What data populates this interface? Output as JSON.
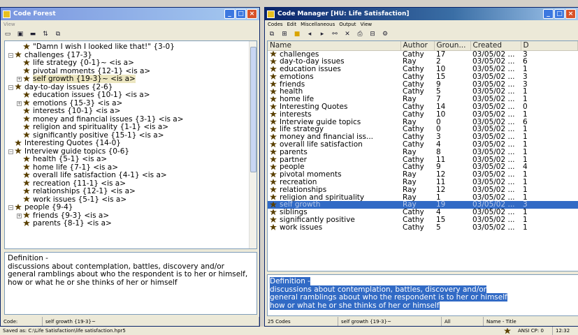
{
  "left_window": {
    "title": "Code Forest",
    "menu": [
      "View"
    ],
    "tree": [
      {
        "indent": 1,
        "expander": "",
        "label": "\"Damn I wish I looked like that!\" {3-0}"
      },
      {
        "indent": 0,
        "expander": "−",
        "label": "challenges {17-3}"
      },
      {
        "indent": 1,
        "expander": "",
        "label": "life strategy {0-1}~ <is a>"
      },
      {
        "indent": 1,
        "expander": "",
        "label": "pivotal moments {12-1} <is a>"
      },
      {
        "indent": 1,
        "expander": "+",
        "label": "self growth {19-3}~ <is a>",
        "selected": true
      },
      {
        "indent": 0,
        "expander": "−",
        "label": "day-to-day issues {2-6}"
      },
      {
        "indent": 1,
        "expander": "",
        "label": "education issues {10-1} <is a>"
      },
      {
        "indent": 1,
        "expander": "+",
        "label": "emotions {15-3} <is a>"
      },
      {
        "indent": 1,
        "expander": "",
        "label": "interests {10-1} <is a>"
      },
      {
        "indent": 1,
        "expander": "",
        "label": "money and financial issues {3-1} <is a>"
      },
      {
        "indent": 1,
        "expander": "",
        "label": "religion and spirituality {1-1} <is a>"
      },
      {
        "indent": 1,
        "expander": "",
        "label": "significantly positive {15-1} <is a>"
      },
      {
        "indent": 0,
        "expander": "",
        "label": "Interesting Quotes {14-0}"
      },
      {
        "indent": 0,
        "expander": "−",
        "label": "Interview guide topics {0-6}"
      },
      {
        "indent": 1,
        "expander": "",
        "label": "health {5-1} <is a>"
      },
      {
        "indent": 1,
        "expander": "",
        "label": "home life {7-1} <is a>"
      },
      {
        "indent": 1,
        "expander": "",
        "label": "overall life satisfaction {4-1} <is a>"
      },
      {
        "indent": 1,
        "expander": "",
        "label": "recreation {11-1} <is a>"
      },
      {
        "indent": 1,
        "expander": "",
        "label": "relationships {12-1} <is a>"
      },
      {
        "indent": 1,
        "expander": "",
        "label": "work issues {5-1} <is a>"
      },
      {
        "indent": 0,
        "expander": "−",
        "label": "people {9-4}"
      },
      {
        "indent": 1,
        "expander": "+",
        "label": "friends {9-3} <is a>"
      },
      {
        "indent": 1,
        "expander": "",
        "label": "parents {8-1} <is a>"
      }
    ],
    "definition": "Definition -\ndiscussions about contemplation, battles, discovery and/or general ramblings about who the respondent is to her or himself, how or what he or she thinks of her or himself",
    "status": {
      "code_label": "Code:",
      "code_value": "self growth {19-3}~"
    }
  },
  "right_window": {
    "title": "Code Manager [HU: Life Satisfaction]",
    "menu": [
      "Codes",
      "Edit",
      "Miscellaneous",
      "Output",
      "View"
    ],
    "columns": [
      "Name",
      "Author",
      "Groun...",
      "Created",
      "D"
    ],
    "rows": [
      [
        "challenges",
        "Cathy",
        "17",
        "03/05/02 ...",
        "3"
      ],
      [
        "day-to-day issues",
        "Ray",
        "2",
        "03/05/02 ...",
        "6"
      ],
      [
        "education issues",
        "Cathy",
        "10",
        "03/05/02 ...",
        "1"
      ],
      [
        "emotions",
        "Cathy",
        "15",
        "03/05/02 ...",
        "3"
      ],
      [
        "friends",
        "Cathy",
        "9",
        "03/05/02 ...",
        "3"
      ],
      [
        "health",
        "Cathy",
        "5",
        "03/05/02 ...",
        "1"
      ],
      [
        "home life",
        "Ray",
        "7",
        "03/05/02 ...",
        "1"
      ],
      [
        "Interesting Quotes",
        "Cathy",
        "14",
        "03/05/02 ...",
        "0"
      ],
      [
        "interests",
        "Cathy",
        "10",
        "03/05/02 ...",
        "1"
      ],
      [
        "Interview guide topics",
        "Ray",
        "0",
        "03/05/02 ...",
        "6"
      ],
      [
        "life strategy",
        "Cathy",
        "0",
        "03/05/02 ...",
        "1"
      ],
      [
        "money and financial iss...",
        "Cathy",
        "3",
        "03/05/02 ...",
        "1"
      ],
      [
        "overall life satisfaction",
        "Cathy",
        "4",
        "03/05/02 ...",
        "1"
      ],
      [
        "parents",
        "Ray",
        "8",
        "03/05/02 ...",
        "1"
      ],
      [
        "partner",
        "Cathy",
        "11",
        "03/05/02 ...",
        "1"
      ],
      [
        "people",
        "Cathy",
        "9",
        "03/05/02 ...",
        "4"
      ],
      [
        "pivotal moments",
        "Ray",
        "12",
        "03/05/02 ...",
        "1"
      ],
      [
        "recreation",
        "Ray",
        "11",
        "03/05/02 ...",
        "1"
      ],
      [
        "relationships",
        "Ray",
        "12",
        "03/05/02 ...",
        "1"
      ],
      [
        "religion and spirituality",
        "Ray",
        "1",
        "03/05/02 ...",
        "1"
      ],
      [
        "self growth",
        "Ray",
        "19",
        "03/05/02 ...",
        "3"
      ],
      [
        "siblings",
        "Cathy",
        "4",
        "03/05/02 ...",
        "1"
      ],
      [
        "significantly positive",
        "Cathy",
        "15",
        "03/05/02 ...",
        "1"
      ],
      [
        "work issues",
        "Cathy",
        "5",
        "03/05/02 ...",
        "1"
      ]
    ],
    "selected_row_index": 20,
    "definition_lines": [
      "Definition -",
      "discussions about contemplation, battles, discovery and/or",
      "general ramblings about who the respondent is to her or himself",
      "how or what he or she thinks of her or himself"
    ],
    "status": {
      "count": "25 Codes",
      "code": "self growth {19-3}~",
      "filter": "All",
      "sort": "Name - Title"
    }
  },
  "app_status": {
    "saved": "Saved as: C:\\Life Satisfaction\\life satisfaction.hpr5",
    "encoding": "ANSI CP: 0",
    "time": "12:32"
  }
}
